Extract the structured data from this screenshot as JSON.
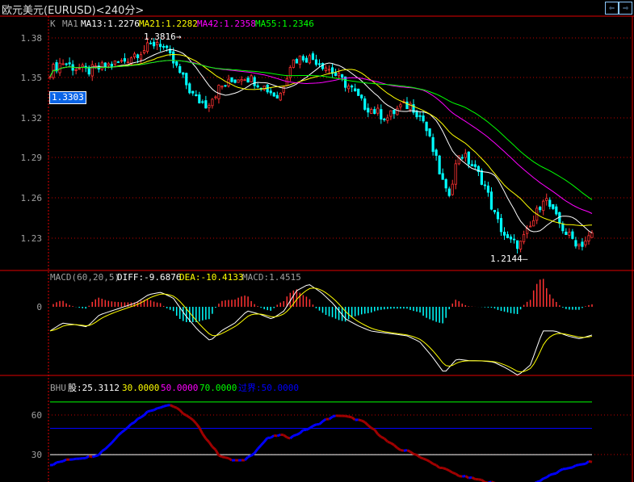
{
  "window": {
    "title": "欧元美元(EURUSD)<240分>",
    "nav_left": "⇦",
    "nav_right": "⇨"
  },
  "main_panel": {
    "legend": {
      "k": "K",
      "ma1": "MA1",
      "ma13": "MA13:1.2276",
      "ma21": "MA21:1.2282",
      "ma42": "MA42:1.2358",
      "ma55": "MA55:1.2346"
    },
    "yticks": [
      "1.38",
      "1.35",
      "1.32",
      "1.29",
      "1.26",
      "1.23"
    ],
    "high_label": "1.3816→",
    "low_label": "1.2144—",
    "last_price": "1.3303"
  },
  "macd_panel": {
    "legend": {
      "name": "MACD(60,20,5)",
      "diff": "DIFF:-9.6876",
      "dea": "DEA:-10.4133",
      "macd": "MACD:1.4515"
    },
    "zero_label": "0"
  },
  "bhu_panel": {
    "legend": {
      "name": "BHU",
      "v1": "股:25.3112",
      "v2": "30.0000",
      "v3": "50.0000",
      "v4": "70.0000",
      "v5": "过界:50.0000"
    },
    "yticks": [
      "60",
      "30"
    ]
  },
  "colors": {
    "up": "#ff3232",
    "down": "#00ffff",
    "grid": "#c00000",
    "ma13": "#ffffff",
    "ma21": "#ffff00",
    "ma42": "#ff00ff",
    "ma55": "#00ff00"
  },
  "chart_data": {
    "type": "candlestick",
    "price_axis": [
      1.2,
      1.39
    ],
    "price_samples": [
      1.355,
      1.362,
      1.358,
      1.355,
      1.357,
      1.36,
      1.362,
      1.368,
      1.372,
      1.378,
      1.365,
      1.35,
      1.335,
      1.33,
      1.342,
      1.347,
      1.352,
      1.348,
      1.342,
      1.335,
      1.362,
      1.366,
      1.364,
      1.358,
      1.35,
      1.342,
      1.33,
      1.325,
      1.32,
      1.328,
      1.33,
      1.318,
      1.29,
      1.26,
      1.295,
      1.285,
      1.272,
      1.245,
      1.228,
      1.225,
      1.24,
      1.262,
      1.245,
      1.232,
      1.225,
      1.232
    ],
    "diff_samples": [
      -8.3,
      -5.6,
      -6.1,
      -6.9,
      -2.8,
      -1.4,
      0,
      1.4,
      4.2,
      5,
      3,
      -3,
      -8,
      -11.7,
      -8,
      -5.6,
      -1.4,
      -2.5,
      -4.2,
      -1.4,
      5.5,
      7.8,
      5,
      1,
      -4.2,
      -6.5,
      -8.3,
      -8.9,
      -9.4,
      -10,
      -12,
      -17,
      -22.8,
      -18,
      -18.5,
      -18.6,
      -19,
      -21,
      -23.6,
      -20,
      -8.3,
      -8.3,
      -10,
      -11,
      -9.7
    ],
    "bhu_samples": [
      22,
      25,
      27,
      28,
      30,
      38,
      48,
      55,
      62,
      66,
      68,
      62,
      55,
      42,
      30,
      26,
      25,
      32,
      42,
      45,
      43,
      48,
      52,
      57,
      60,
      58,
      55,
      48,
      40,
      34,
      32,
      27,
      22,
      18,
      14,
      12,
      10,
      8,
      6,
      5,
      7,
      12,
      16,
      20,
      22,
      25
    ],
    "bhu_levels": [
      30,
      50,
      70
    ],
    "bhu_axis": [
      0,
      100
    ]
  }
}
